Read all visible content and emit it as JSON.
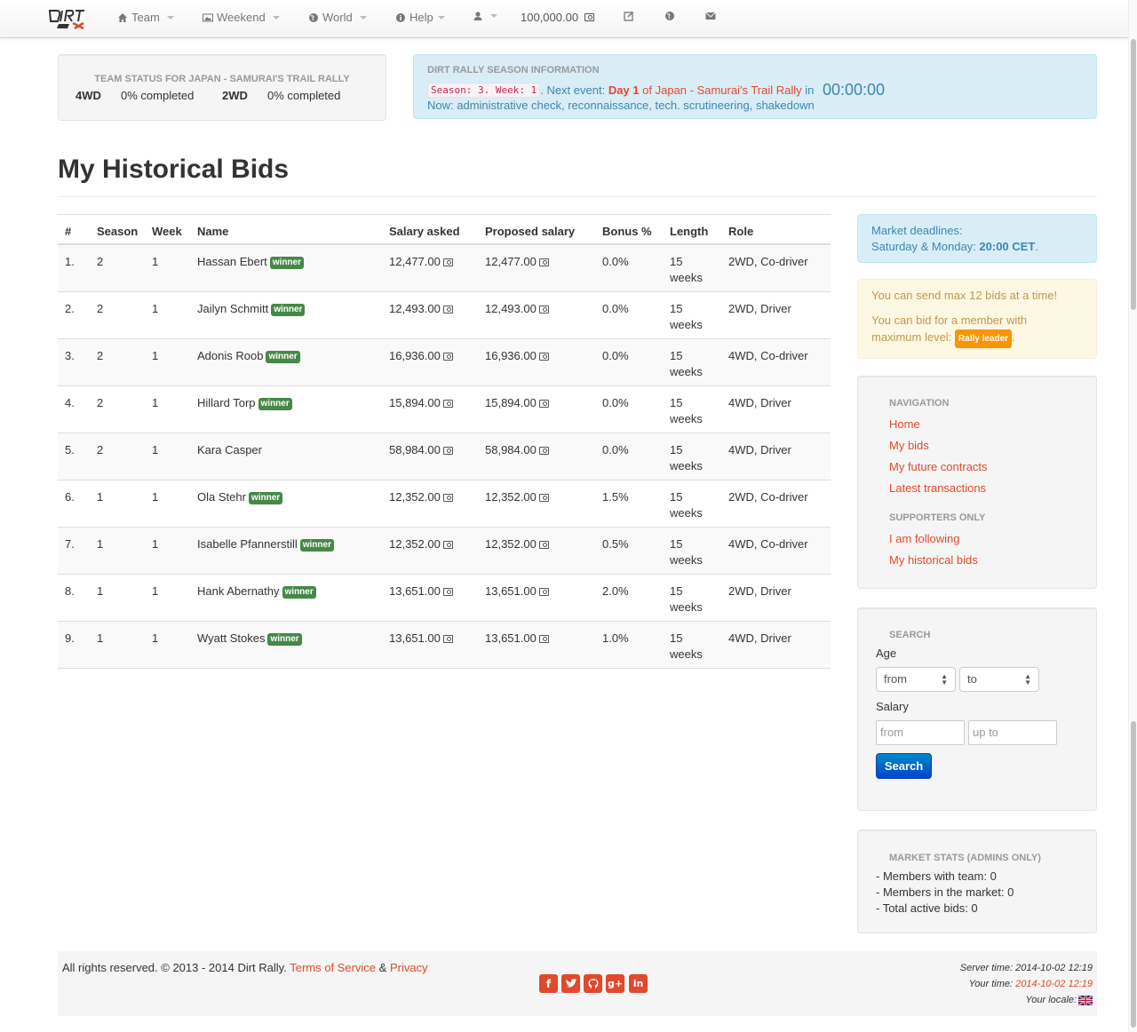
{
  "navbar": {
    "brand": "DIRT RALLY",
    "team": "Team",
    "weekend": "Weekend",
    "world": "World",
    "help": "Help",
    "money": "100,000.00"
  },
  "team_status": {
    "title": "TEAM STATUS FOR JAPAN - SAMURAI'S TRAIL RALLY",
    "a_label": "4WD",
    "a_value": "0% completed",
    "b_label": "2WD",
    "b_value": "0% completed"
  },
  "season_info": {
    "title": "DIRT RALLY SEASON INFORMATION",
    "code": "Season: 3. Week: 1",
    "next_prefix": ". Next event: ",
    "day": "Day 1",
    "of": " of ",
    "event": "Japan - Samurai's Trail Rally",
    "in": " in ",
    "countdown": "00:00:00",
    "now": "Now: administrative check, reconnaissance, tech. scrutineering, shakedown"
  },
  "page_title": "My Historical Bids",
  "table": {
    "headers": [
      "#",
      "Season",
      "Week",
      "Name",
      "Salary asked",
      "Proposed salary",
      "Bonus %",
      "Length",
      "Role"
    ],
    "badge_label": "winner",
    "length_unit": "weeks",
    "rows": [
      {
        "num": "1.",
        "season": "2",
        "week": "1",
        "name": "Hassan Ebert",
        "winner": true,
        "asked": "12,477.00",
        "proposed": "12,477.00",
        "bonus": "0.0%",
        "length": "15",
        "role": "2WD, Co-driver"
      },
      {
        "num": "2.",
        "season": "2",
        "week": "1",
        "name": "Jailyn Schmitt",
        "winner": true,
        "asked": "12,493.00",
        "proposed": "12,493.00",
        "bonus": "0.0%",
        "length": "15",
        "role": "2WD, Driver"
      },
      {
        "num": "3.",
        "season": "2",
        "week": "1",
        "name": "Adonis Roob",
        "winner": true,
        "asked": "16,936.00",
        "proposed": "16,936.00",
        "bonus": "0.0%",
        "length": "15",
        "role": "4WD, Co-driver"
      },
      {
        "num": "4.",
        "season": "2",
        "week": "1",
        "name": "Hillard Torp",
        "winner": true,
        "asked": "15,894.00",
        "proposed": "15,894.00",
        "bonus": "0.0%",
        "length": "15",
        "role": "4WD, Driver"
      },
      {
        "num": "5.",
        "season": "2",
        "week": "1",
        "name": "Kara Casper",
        "winner": false,
        "asked": "58,984.00",
        "proposed": "58,984.00",
        "bonus": "0.0%",
        "length": "15",
        "role": "4WD, Driver"
      },
      {
        "num": "6.",
        "season": "1",
        "week": "1",
        "name": "Ola Stehr",
        "winner": true,
        "asked": "12,352.00",
        "proposed": "12,352.00",
        "bonus": "1.5%",
        "length": "15",
        "role": "2WD, Co-driver"
      },
      {
        "num": "7.",
        "season": "1",
        "week": "1",
        "name": "Isabelle Pfannerstill",
        "winner": true,
        "asked": "12,352.00",
        "proposed": "12,352.00",
        "bonus": "0.5%",
        "length": "15",
        "role": "4WD, Co-driver"
      },
      {
        "num": "8.",
        "season": "1",
        "week": "1",
        "name": "Hank Abernathy",
        "winner": true,
        "asked": "13,651.00",
        "proposed": "13,651.00",
        "bonus": "2.0%",
        "length": "15",
        "role": "2WD, Driver"
      },
      {
        "num": "9.",
        "season": "1",
        "week": "1",
        "name": "Wyatt Stokes",
        "winner": true,
        "asked": "13,651.00",
        "proposed": "13,651.00",
        "bonus": "1.0%",
        "length": "15",
        "role": "4WD, Driver"
      }
    ]
  },
  "sidebar": {
    "deadlines_label": "Market deadlines:",
    "deadlines_days": "Saturday & Monday: ",
    "deadlines_time": "20:00 CET",
    "deadlines_dot": ".",
    "max_bids": "You can send max 12 bids at a time!",
    "bid_level": "You can bid for a member with maximum level: ",
    "level_label": "Rally leader",
    "level_dot": ".",
    "nav_head": "NAVIGATION",
    "nav_links": [
      "Home",
      "My bids",
      "My future contracts",
      "Latest transactions"
    ],
    "supporters_head": "SUPPORTERS ONLY",
    "supporters_links": [
      "I am following",
      "My historical bids"
    ],
    "search_head": "SEARCH",
    "age_label": "Age",
    "age_from": "from",
    "age_to": "to",
    "salary_label": "Salary",
    "salary_from_placeholder": "from",
    "salary_to_placeholder": "up to",
    "search_button": "Search",
    "stats_head": "MARKET STATS (ADMINS ONLY)",
    "stats": [
      "- Members with team: 0",
      "- Members in the market: 0",
      "- Total active bids: 0"
    ]
  },
  "footer": {
    "rights": "All rights reserved. © 2013 - 2014 Dirt Rally. ",
    "terms": "Terms of Service",
    "amp": " & ",
    "privacy": "Privacy",
    "server_label": "Server time: ",
    "server_time": "2014-10-02 12:19",
    "your_label": "Your time: ",
    "your_time": "2014-10-02 12:19",
    "locale_label": "Your locale: "
  },
  "colors": {
    "accent": "#e2492c",
    "winner": "#468847",
    "info_bg": "#d9edf7",
    "warn_bg": "#fcf8e3"
  }
}
